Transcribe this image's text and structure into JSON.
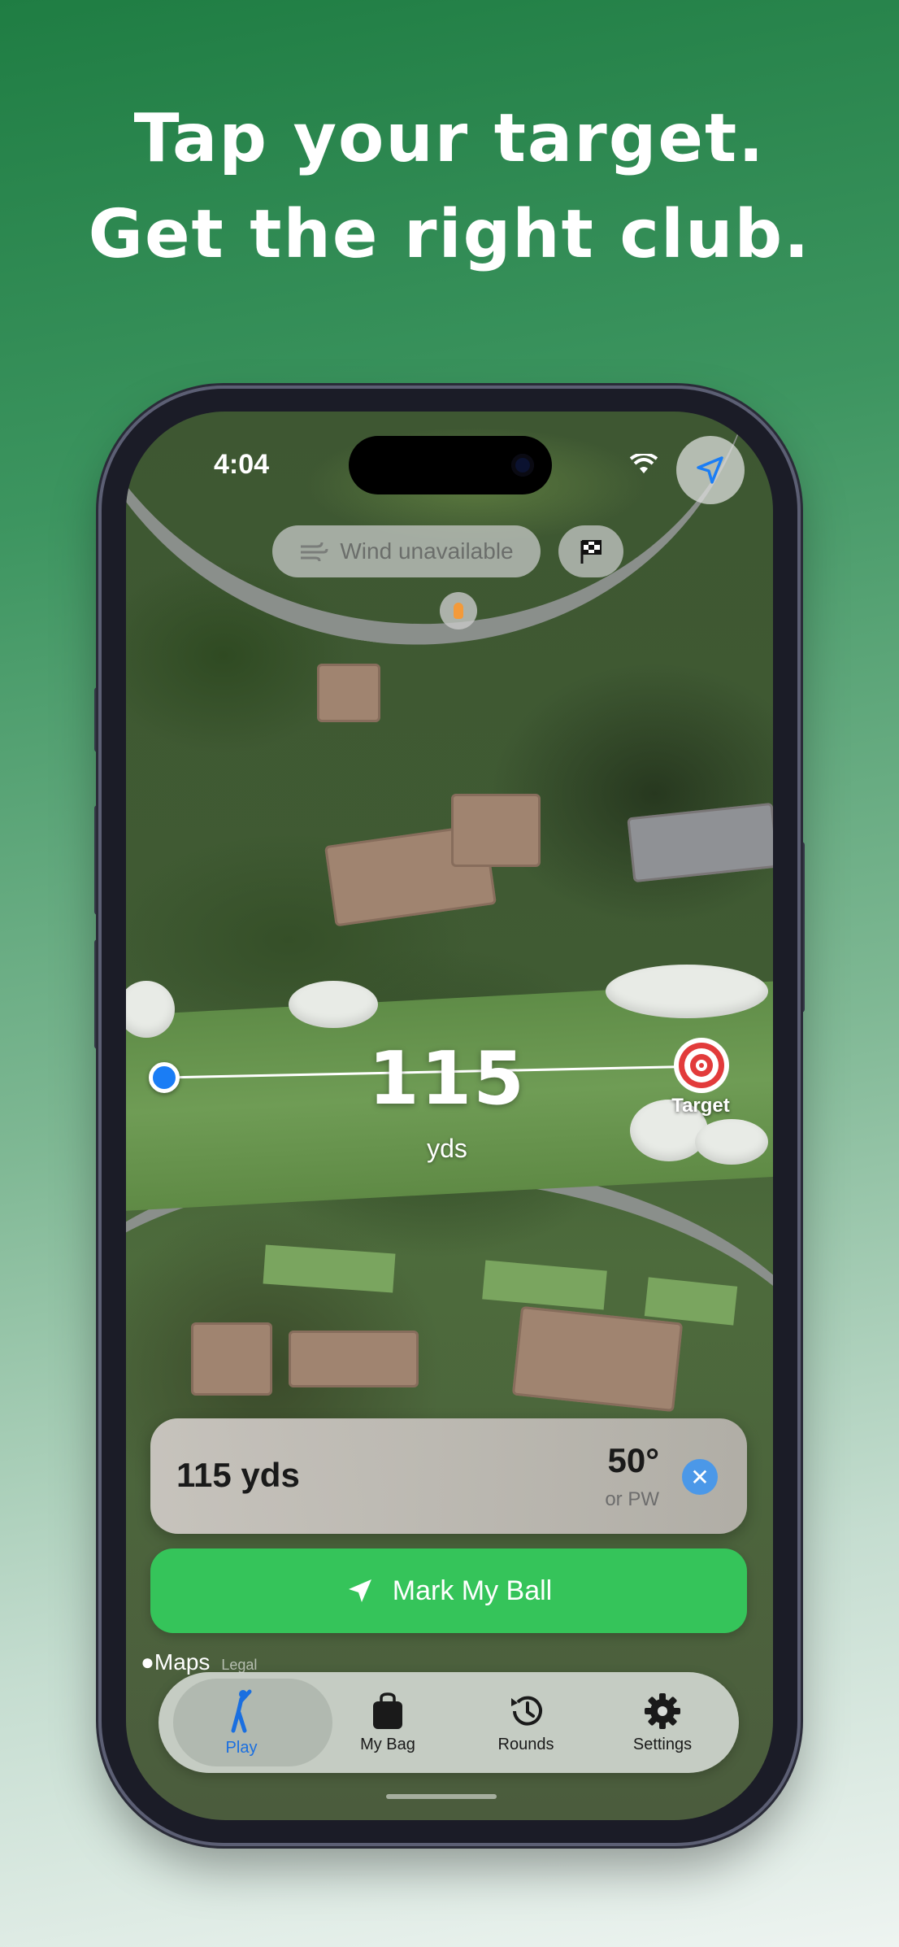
{
  "headline": {
    "line1": "Tap your target.",
    "line2": "Get the right club."
  },
  "status_bar": {
    "time": "4:04"
  },
  "map": {
    "wind": "Wind unavailable",
    "distance_value": "115",
    "distance_unit": "yds",
    "target_label": "Target",
    "maps_credit": "Maps",
    "legal": "Legal"
  },
  "club_card": {
    "distance": "115 yds",
    "club": "50°",
    "alternative": "or PW"
  },
  "primary_action": {
    "label": "Mark My Ball"
  },
  "tabbar": {
    "tabs": [
      {
        "label": "Play",
        "icon": "golfer-icon",
        "active": true
      },
      {
        "label": "My Bag",
        "icon": "bag-icon",
        "active": false
      },
      {
        "label": "Rounds",
        "icon": "history-icon",
        "active": false
      },
      {
        "label": "Settings",
        "icon": "gear-icon",
        "active": false
      }
    ]
  },
  "colors": {
    "accent_green": "#35c45a",
    "active_tab": "#1a6fe0",
    "ball_marker": "#1a7df5",
    "target_red": "#e23b3b"
  }
}
